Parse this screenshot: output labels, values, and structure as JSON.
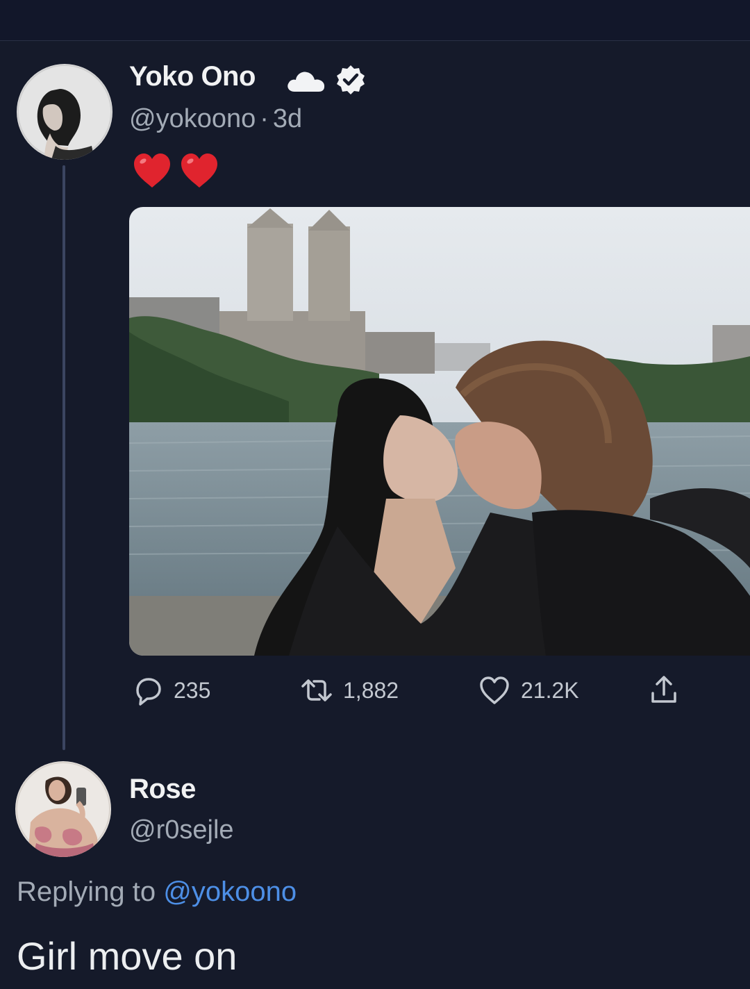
{
  "tweet": {
    "author": {
      "name": "Yoko Ono",
      "handle": "@yokoono",
      "separator": "·",
      "time": "3d",
      "badges": [
        "cloud-icon",
        "verified-icon"
      ]
    },
    "text_icons": [
      "red-heart-icon",
      "red-heart-icon"
    ],
    "media": {
      "kind": "photo"
    },
    "stats": {
      "replies": "235",
      "retweets": "1,882",
      "likes": "21.2K"
    }
  },
  "reply": {
    "author": {
      "name": "Rose",
      "handle": "@r0sejle"
    },
    "replying_prefix": "Replying to",
    "replying_to": "@yokoono",
    "text": "Girl move on"
  },
  "colors": {
    "background": "#151a2a",
    "link": "#4d8fe6",
    "secondary_text": "#a3abb6",
    "heart": "#e0242e"
  }
}
